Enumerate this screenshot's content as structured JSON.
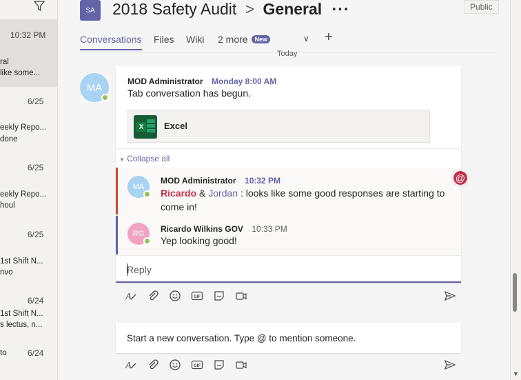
{
  "chat_list": {
    "items": [
      {
        "time": "10:32 PM",
        "line1": "ral",
        "line2": "like some...",
        "active": true
      },
      {
        "time": "6/25",
        "line1": "",
        "line2": ""
      },
      {
        "time": "",
        "line1": "eekly Repo...",
        "line2": "done"
      },
      {
        "time": "6/25",
        "line1": "",
        "line2": ""
      },
      {
        "time": "",
        "line1": "eekly Repo...",
        "line2": "houl"
      },
      {
        "time": "6/25",
        "line1": "",
        "line2": ""
      },
      {
        "time": "",
        "line1": "1st Shift N...",
        "line2": "nvo"
      },
      {
        "time": "6/24",
        "line1": "",
        "line2": ""
      },
      {
        "time": "",
        "line1": "1st Shift N...",
        "line2": "s lectus, n..."
      },
      {
        "time": "6/24",
        "line1": "to",
        "line2": ""
      }
    ]
  },
  "header": {
    "team_initials": "SA",
    "team_name": "2018 Safety Audit",
    "separator": ">",
    "channel_name": "General",
    "more": "···",
    "visibility": "Public"
  },
  "tabs": {
    "conversations": "Conversations",
    "files": "Files",
    "wiki": "Wiki",
    "more": "2 more",
    "new_badge": "New",
    "chevron": "∨",
    "add": "+"
  },
  "divider_label": "Today",
  "thread": {
    "author_initials": "MA",
    "author": "MOD Administrator",
    "time": "Monday 8:00 AM",
    "message": "Tab conversation has begun.",
    "attachment": "Excel",
    "collapse_label": "Collapse all",
    "replies": [
      {
        "initials": "MA",
        "author": "MOD Administrator",
        "time": "10:32 PM",
        "mention1": "Ricardo",
        "amp": " & ",
        "mention2": "Jordan",
        "text": " : looks like some good responses are starting to come in!"
      },
      {
        "initials": "RG",
        "author": "Ricardo Wilkins GOV",
        "time": "10:33 PM",
        "text": "Yep looking good!"
      }
    ],
    "reply_placeholder": "Reply"
  },
  "new_conversation_placeholder": "Start a new conversation. Type @ to mention someone.",
  "colors": {
    "accent": "#6264a7",
    "mention": "#c4314b",
    "presence": "#92c353",
    "ma_avatar": "#a9d3f2",
    "rg_avatar": "#f1a3c3"
  }
}
